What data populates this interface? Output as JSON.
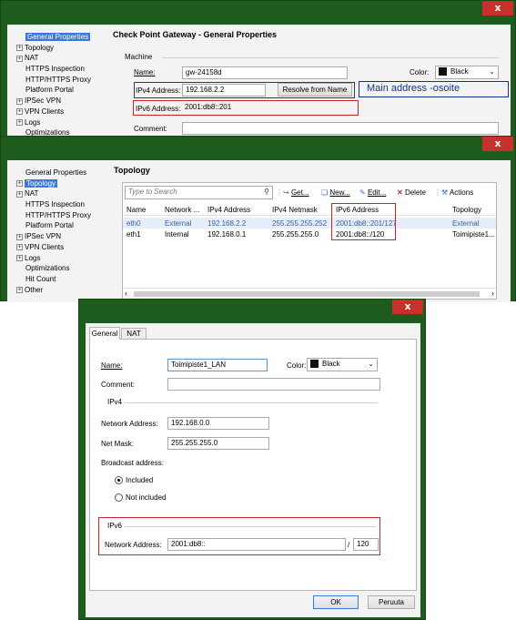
{
  "colors": {
    "frame": "#1e5c1e",
    "close": "#c9302c",
    "selection": "#3a79d7",
    "highlight_red": "#c62828",
    "note_blue": "#1a2f8a",
    "row_blue_text": "#2f5fb3"
  },
  "win1": {
    "close": "x",
    "tree": [
      {
        "label": "General Properties",
        "selected": true,
        "expand": ""
      },
      {
        "label": "Topology",
        "expand": "+"
      },
      {
        "label": "NAT",
        "expand": "+"
      },
      {
        "label": "HTTPS Inspection",
        "expand": ""
      },
      {
        "label": "HTTP/HTTPS Proxy",
        "expand": ""
      },
      {
        "label": "Platform Portal",
        "expand": ""
      },
      {
        "label": "IPSec VPN",
        "expand": "+"
      },
      {
        "label": "VPN Clients",
        "expand": "+"
      },
      {
        "label": "Logs",
        "expand": "+"
      },
      {
        "label": "Optimizations",
        "expand": ""
      }
    ],
    "heading": "Check Point Gateway - General Properties",
    "section": "Machine",
    "name_label": "Name:",
    "name_value": "gw-24158d",
    "color_label": "Color:",
    "color_value": "Black",
    "ipv4_label": "IPv4 Address:",
    "ipv4_value": "192.168.2.2",
    "resolve_button": "Resolve from Name",
    "note": "Main address -osoite",
    "ipv6_label": "IPv6 Address:",
    "ipv6_value": "2001:db8::201",
    "comment_label": "Comment:"
  },
  "win2": {
    "close": "x",
    "tree": [
      {
        "label": "General Properties",
        "expand": ""
      },
      {
        "label": "Topology",
        "selected": true,
        "expand": "+"
      },
      {
        "label": "NAT",
        "expand": "+"
      },
      {
        "label": "HTTPS Inspection",
        "expand": ""
      },
      {
        "label": "HTTP/HTTPS Proxy",
        "expand": ""
      },
      {
        "label": "Platform Portal",
        "expand": ""
      },
      {
        "label": "IPSec VPN",
        "expand": "+"
      },
      {
        "label": "VPN Clients",
        "expand": "+"
      },
      {
        "label": "Logs",
        "expand": "+"
      },
      {
        "label": "Optimizations",
        "expand": ""
      },
      {
        "label": "Hit Count",
        "expand": ""
      },
      {
        "label": "Other",
        "expand": "+"
      }
    ],
    "heading": "Topology",
    "search_placeholder": "Type to Search",
    "toolbar": {
      "get": "Get...",
      "new": "New...",
      "edit": "Edit...",
      "delete": "Delete",
      "actions": "Actions"
    },
    "columns": [
      "Name",
      "Network ...",
      "IPv4 Address",
      "IPv4 Netmask",
      "IPv6 Address",
      "Topology"
    ],
    "rows": [
      [
        "eth0",
        "External",
        "192.168.2.2",
        "255.255.255.252",
        "2001:db8::201/127",
        "External"
      ],
      [
        "eth1",
        "Internal",
        "192.168.0.1",
        "255.255.255.0",
        "2001:db8::/120",
        "Toimipiste1..."
      ]
    ]
  },
  "win3": {
    "close": "x",
    "tabs": [
      "General",
      "NAT"
    ],
    "name_label": "Name:",
    "name_value": "Toimipiste1_LAN",
    "color_label": "Color:",
    "color_value": "Black",
    "comment_label": "Comment:",
    "ipv4_section": "IPv4",
    "network_address_label": "Network Address:",
    "network_address_value": "192.168.0.0",
    "netmask_label": "Net Mask:",
    "netmask_value": "255.255.255.0",
    "broadcast_label": "Broadcast address:",
    "included_label": "Included",
    "not_included_label": "Not included",
    "ipv6_section": "IPv6",
    "ipv6_network_label": "Network Address:",
    "ipv6_network_value": "2001:db8::",
    "slash": "/",
    "prefix_value": "120",
    "ok_button": "OK",
    "cancel_button": "Peruuta"
  }
}
